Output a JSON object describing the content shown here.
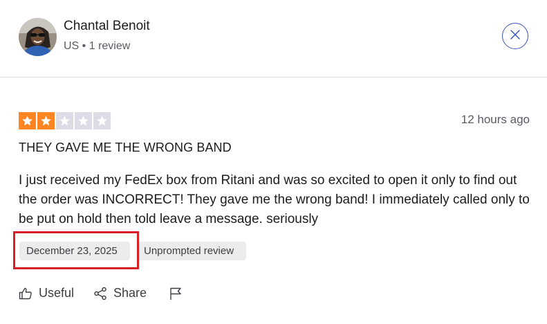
{
  "reviewer": {
    "name": "Chantal Benoit",
    "meta": "US • 1 review"
  },
  "review": {
    "rating": 2,
    "max_rating": 5,
    "timestamp": "12 hours ago",
    "title": "THEY GAVE ME THE WRONG BAND",
    "body": "I just received my FedEx box from Ritani and was so excited to open it only to find out the order was INCORRECT! They gave me the wrong band! I immediately called only to be put on hold then told leave a message. seriously",
    "date_badge": "December 23, 2025",
    "type_badge": "Unprompted review"
  },
  "actions": {
    "useful_label": "Useful",
    "share_label": "Share"
  },
  "colors": {
    "star_filled": "#ff8622",
    "star_empty": "#dcdce6",
    "accent": "#3c57bc",
    "highlight": "#d81f27"
  },
  "icons": {
    "close": "close-icon",
    "useful": "thumbs-up-icon",
    "share": "share-icon",
    "report": "flag-icon"
  }
}
